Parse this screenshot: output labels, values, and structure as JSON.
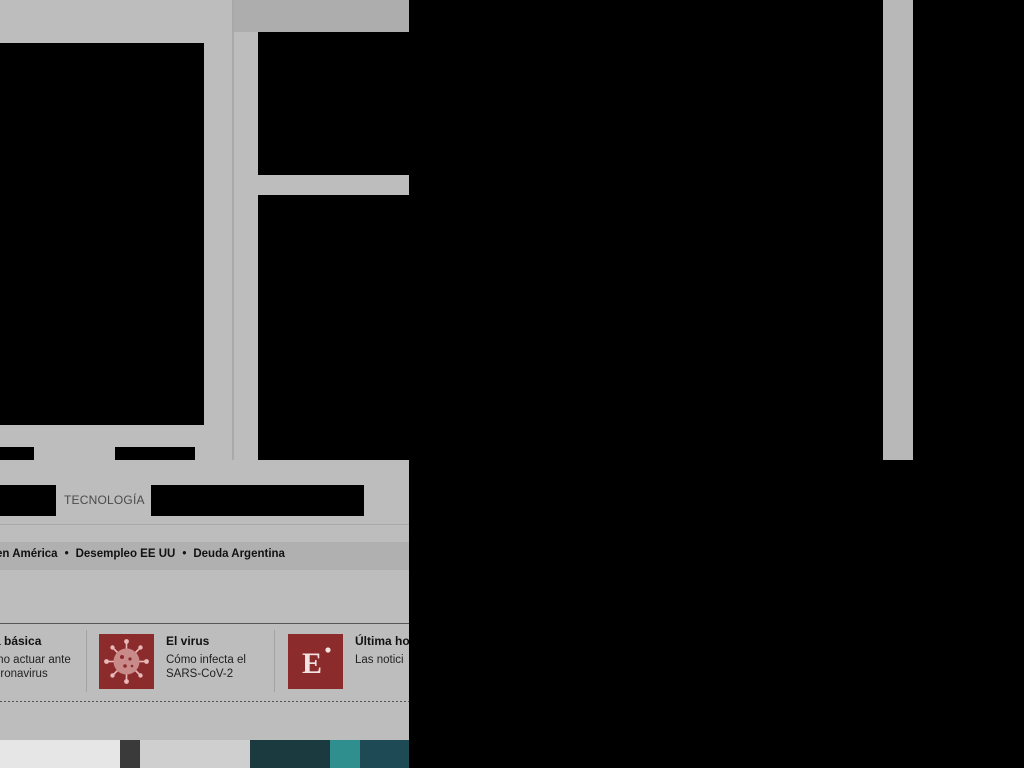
{
  "nav": {
    "section_tecnologia": "TECNOLOGÍA"
  },
  "topics": {
    "items": [
      "en América",
      "Desempleo EE UU",
      "Deuda Argentina"
    ]
  },
  "cards": [
    {
      "title": "a básica",
      "line1": "mo actuar ante",
      "line2": "oronavirus"
    },
    {
      "title": "El virus",
      "line1": "Cómo infecta el",
      "line2": "SARS-CoV-2",
      "icon": "virus-icon"
    },
    {
      "title": "Última ho",
      "line1": "Las notici",
      "icon": "el-pais-e-logo"
    }
  ],
  "colors": {
    "card_icon_bg": "#8b2b2b",
    "page_bg": "#bdbdbd"
  }
}
